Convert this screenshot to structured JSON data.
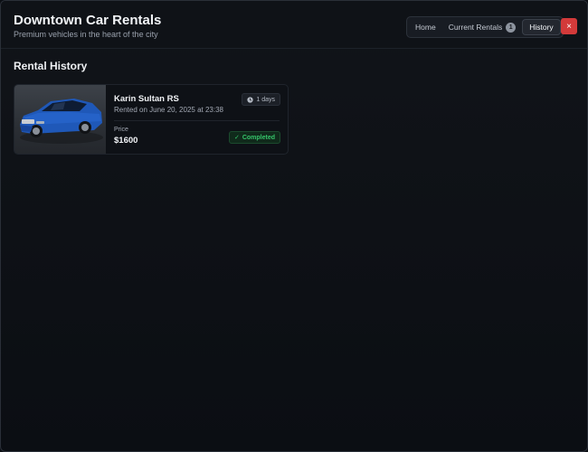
{
  "header": {
    "title": "Downtown Car Rentals",
    "subtitle": "Premium vehicles in the heart of the city"
  },
  "nav": {
    "items": [
      {
        "label": "Home",
        "active": false
      },
      {
        "label": "Current Rentals",
        "active": false,
        "count": "1"
      },
      {
        "label": "History",
        "active": true
      }
    ],
    "close_label": "×"
  },
  "section": {
    "title": "Rental History"
  },
  "rentals": [
    {
      "car_name": "Karin Sultan RS",
      "rented_on": "Rented on June 20, 2025 at 23:38",
      "duration": "1 days",
      "price_label": "Price",
      "price": "$1600",
      "status": "Completed",
      "image_icon": "blue-sedan-car-image"
    }
  ],
  "colors": {
    "accent_close": "#d33a3a",
    "status_completed": "#35c46a",
    "background": "#0b0e13"
  }
}
